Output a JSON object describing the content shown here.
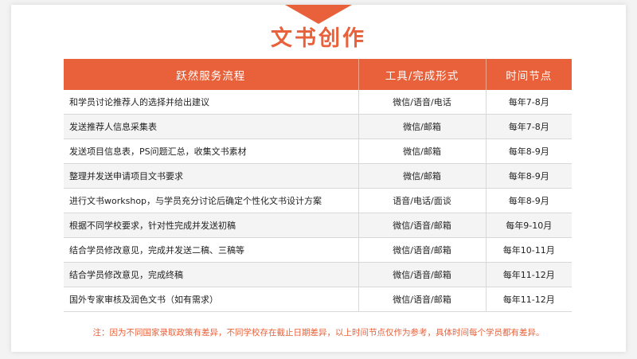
{
  "page_title": "文书创作",
  "table": {
    "headers": [
      "跃然服务流程",
      "工具/完成形式",
      "时间节点"
    ],
    "rows": [
      [
        "和学员讨论推荐人的选择并给出建议",
        "微信/语音/电话",
        "每年7-8月"
      ],
      [
        "发送推荐人信息采集表",
        "微信/邮箱",
        "每年7-8月"
      ],
      [
        "发送项目信息表，PS问题汇总，收集文书素材",
        "微信/邮箱",
        "每年8-9月"
      ],
      [
        "整理并发送申请项目文书要求",
        "微信/邮箱",
        "每年8-9月"
      ],
      [
        "进行文书workshop，与学员充分讨论后确定个性化文书设计方案",
        "语音/电话/面谈",
        "每年8-9月"
      ],
      [
        "根据不同学校要求，针对性完成并发送初稿",
        "微信/语音/邮箱",
        "每年9-10月"
      ],
      [
        "结合学员修改意见，完成并发送二稿、三稿等",
        "微信/语音/邮箱",
        "每年10-11月"
      ],
      [
        "结合学员修改意见，完成终稿",
        "微信/语音/邮箱",
        "每年11-12月"
      ],
      [
        "国外专家审核及润色文书（如有需求）",
        "微信/语音/邮箱",
        "每年11-12月"
      ]
    ]
  },
  "footnote": "注：因为不同国家录取政策有差异，不同学校存在截止日期差异，以上时间节点仅作为参考，具体时间每个学员都有差异。",
  "colors": {
    "accent": "#e8613a",
    "row_alt": "#f4f4f4",
    "border": "#d8d8d8"
  }
}
